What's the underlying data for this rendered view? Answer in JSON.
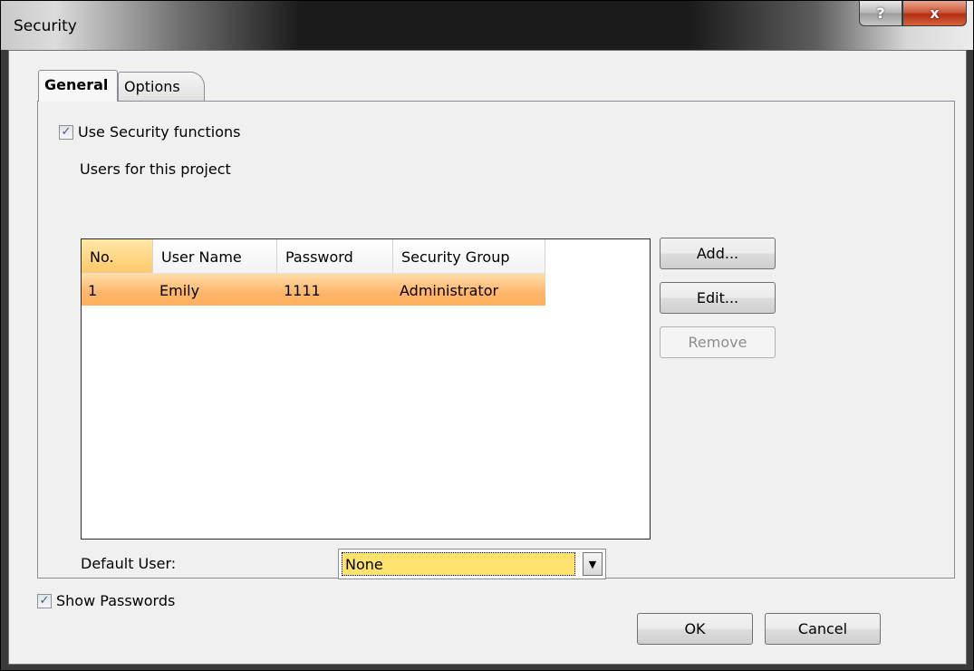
{
  "window": {
    "title": "Security",
    "help_glyph": "?",
    "close_glyph": "x"
  },
  "tabs": [
    {
      "label": "General",
      "active": true
    },
    {
      "label": "Options",
      "active": false
    }
  ],
  "general": {
    "use_security": {
      "label": "Use Security functions",
      "checked": true
    },
    "users_label": "Users for this project",
    "table": {
      "columns": [
        "No.",
        "User Name",
        "Password",
        "Security Group"
      ],
      "rows": [
        [
          "1",
          "Emily",
          "1111",
          "Administrator"
        ]
      ]
    },
    "buttons": {
      "add": "Add...",
      "edit": "Edit...",
      "remove": "Remove"
    },
    "default_user": {
      "label": "Default User:",
      "value": "None"
    }
  },
  "show_passwords": {
    "label": "Show Passwords",
    "checked": true
  },
  "footer": {
    "ok": "OK",
    "cancel": "Cancel"
  },
  "icons": {
    "checkmark": "check-icon",
    "dropdown": "chevron-down-icon"
  }
}
